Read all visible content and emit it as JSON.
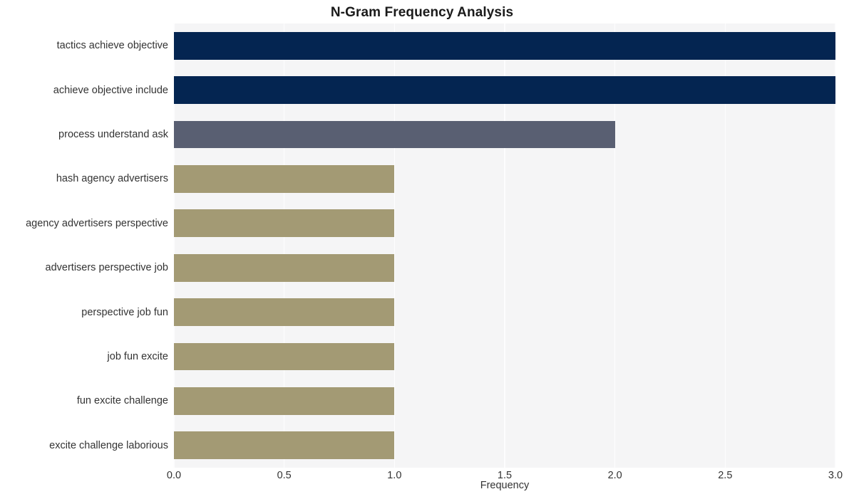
{
  "chart_data": {
    "type": "bar",
    "orientation": "horizontal",
    "title": "N-Gram Frequency Analysis",
    "xlabel": "Frequency",
    "ylabel": "",
    "xlim": [
      0.0,
      3.0
    ],
    "xticks": [
      "0.0",
      "0.5",
      "1.0",
      "1.5",
      "2.0",
      "2.5",
      "3.0"
    ],
    "xtick_values": [
      0.0,
      0.5,
      1.0,
      1.5,
      2.0,
      2.5,
      3.0
    ],
    "grid": "vertical-white-on-light-gray",
    "legend": "none",
    "categories": [
      "tactics achieve objective",
      "achieve objective include",
      "process understand ask",
      "hash agency advertisers",
      "agency advertisers perspective",
      "advertisers perspective job",
      "perspective job fun",
      "job fun excite",
      "fun excite challenge",
      "excite challenge laborious"
    ],
    "values": [
      3,
      3,
      2,
      1,
      1,
      1,
      1,
      1,
      1,
      1
    ],
    "bar_colors": [
      "#042551",
      "#042551",
      "#595f72",
      "#a39a74",
      "#a39a74",
      "#a39a74",
      "#a39a74",
      "#a39a74",
      "#a39a74",
      "#a39a74"
    ]
  },
  "style": {
    "plot_background": "#f5f5f6",
    "figure_background": "#ffffff",
    "gridline_color": "#fdfdfe",
    "text_color": "#333333",
    "title_color": "#1a1a1a"
  }
}
